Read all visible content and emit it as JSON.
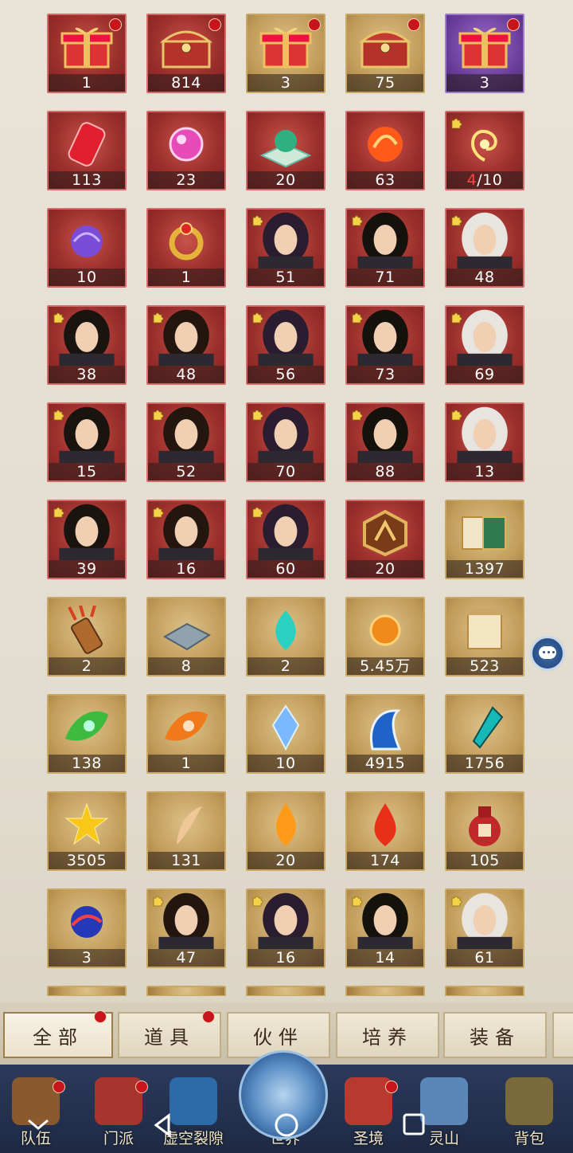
{
  "items": [
    {
      "qty": "1",
      "bg": "red",
      "art": "gift-box",
      "dot": true
    },
    {
      "qty": "814",
      "bg": "red",
      "art": "treasure-chest",
      "dot": true
    },
    {
      "qty": "3",
      "bg": "gold",
      "art": "gift-box",
      "dot": true
    },
    {
      "qty": "75",
      "bg": "gold",
      "art": "treasure-chest",
      "dot": true
    },
    {
      "qty": "3",
      "bg": "purple",
      "art": "gift-box",
      "dot": true
    },
    {
      "qty": "113",
      "bg": "red",
      "art": "red-token"
    },
    {
      "qty": "23",
      "bg": "red",
      "art": "pink-orb"
    },
    {
      "qty": "20",
      "bg": "red",
      "art": "jade-plate"
    },
    {
      "qty": "63",
      "bg": "red",
      "art": "fire-dragon"
    },
    {
      "qty_hl": "4",
      "qty_rest": "/10",
      "bg": "red",
      "art": "golden-swirl",
      "puzzle": true
    },
    {
      "qty": "10",
      "bg": "red",
      "art": "purple-orb"
    },
    {
      "qty": "1",
      "bg": "red",
      "art": "ring"
    },
    {
      "qty": "51",
      "bg": "red",
      "art": "portrait",
      "puzzle": true
    },
    {
      "qty": "71",
      "bg": "red",
      "art": "portrait",
      "puzzle": true
    },
    {
      "qty": "48",
      "bg": "red",
      "art": "portrait",
      "puzzle": true
    },
    {
      "qty": "38",
      "bg": "red",
      "art": "portrait",
      "puzzle": true
    },
    {
      "qty": "48",
      "bg": "red",
      "art": "portrait",
      "puzzle": true
    },
    {
      "qty": "56",
      "bg": "red",
      "art": "portrait",
      "puzzle": true
    },
    {
      "qty": "73",
      "bg": "red",
      "art": "portrait",
      "puzzle": true
    },
    {
      "qty": "69",
      "bg": "red",
      "art": "portrait",
      "puzzle": true
    },
    {
      "qty": "15",
      "bg": "red",
      "art": "portrait",
      "puzzle": true
    },
    {
      "qty": "52",
      "bg": "red",
      "art": "portrait",
      "puzzle": true
    },
    {
      "qty": "70",
      "bg": "red",
      "art": "portrait",
      "puzzle": true
    },
    {
      "qty": "88",
      "bg": "red",
      "art": "portrait",
      "puzzle": true
    },
    {
      "qty": "13",
      "bg": "red",
      "art": "portrait",
      "puzzle": true
    },
    {
      "qty": "39",
      "bg": "red",
      "art": "portrait",
      "puzzle": true
    },
    {
      "qty": "16",
      "bg": "red",
      "art": "portrait",
      "puzzle": true
    },
    {
      "qty": "60",
      "bg": "red",
      "art": "portrait",
      "puzzle": true
    },
    {
      "qty": "20",
      "bg": "red",
      "art": "emblem"
    },
    {
      "qty": "1397",
      "bg": "gold",
      "art": "book"
    },
    {
      "qty": "2",
      "bg": "gold",
      "art": "quiver"
    },
    {
      "qty": "8",
      "bg": "gold",
      "art": "stone-tablet"
    },
    {
      "qty": "2",
      "bg": "gold",
      "art": "blue-flame"
    },
    {
      "qty": "5.45万",
      "bg": "gold",
      "art": "amber-orb"
    },
    {
      "qty": "523",
      "bg": "gold",
      "art": "scroll"
    },
    {
      "qty": "138",
      "bg": "gold",
      "art": "green-leaf"
    },
    {
      "qty": "1",
      "bg": "gold",
      "art": "orange-leaf"
    },
    {
      "qty": "10",
      "bg": "gold",
      "art": "crystal"
    },
    {
      "qty": "4915",
      "bg": "gold",
      "art": "wave"
    },
    {
      "qty": "1756",
      "bg": "gold",
      "art": "dagger"
    },
    {
      "qty": "3505",
      "bg": "gold",
      "art": "gold-flower"
    },
    {
      "qty": "131",
      "bg": "gold",
      "art": "feather"
    },
    {
      "qty": "20",
      "bg": "gold",
      "art": "flame"
    },
    {
      "qty": "174",
      "bg": "gold",
      "art": "red-drop"
    },
    {
      "qty": "105",
      "bg": "gold",
      "art": "wine-jar"
    },
    {
      "qty": "3",
      "bg": "gold",
      "art": "storm-orb"
    },
    {
      "qty": "47",
      "bg": "gold",
      "art": "portrait",
      "puzzle": true
    },
    {
      "qty": "16",
      "bg": "gold",
      "art": "portrait",
      "puzzle": true
    },
    {
      "qty": "14",
      "bg": "gold",
      "art": "portrait",
      "puzzle": true
    },
    {
      "qty": "61",
      "bg": "gold",
      "art": "portrait",
      "puzzle": true
    }
  ],
  "tabs": [
    {
      "label": "全部",
      "active": true,
      "dot": true
    },
    {
      "label": "道具",
      "dot": true
    },
    {
      "label": "伙伴"
    },
    {
      "label": "培养"
    },
    {
      "label": "装备"
    }
  ],
  "nav": [
    {
      "label": "队伍",
      "dot": true
    },
    {
      "label": "门派",
      "dot": true
    },
    {
      "label": "虚空裂隙"
    },
    {
      "label": "世界"
    },
    {
      "label": "圣境",
      "dot": true
    },
    {
      "label": "灵山"
    },
    {
      "label": "背包"
    }
  ],
  "colors": {
    "accent_red": "#c8151b",
    "nav_bg": "#1e2a44",
    "highlight_text": "#ff4444"
  }
}
